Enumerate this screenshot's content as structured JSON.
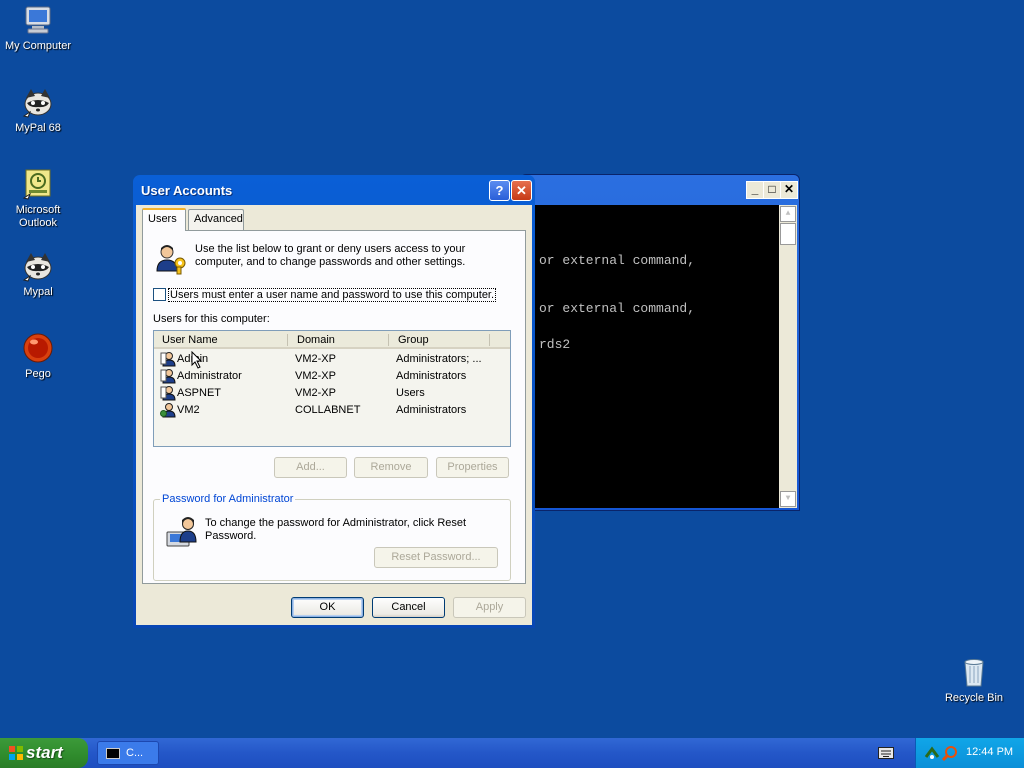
{
  "desktop": {
    "icons": [
      {
        "label": "My Computer",
        "icon": "computer-icon"
      },
      {
        "label": "MyPal 68",
        "icon": "raccoon-icon"
      },
      {
        "label": "Microsoft Outlook",
        "icon": "outlook-icon"
      },
      {
        "label": "Mypal",
        "icon": "raccoon-icon"
      },
      {
        "label": "Pego",
        "icon": "red-ball-icon"
      },
      {
        "label": "Recycle Bin",
        "icon": "recycle-bin-icon"
      }
    ]
  },
  "console": {
    "lines": [
      "or external command,",
      "or external command,",
      "rds2"
    ]
  },
  "dialog": {
    "title": "User Accounts",
    "help_glyph": "?",
    "close_glyph": "✕",
    "tabs": [
      "Users",
      "Advanced"
    ],
    "intro": "Use the list below to grant or deny users access to your computer, and to change passwords and other settings.",
    "checkbox_label": "Users must enter a user name and password to use this computer.",
    "checkbox_checked": false,
    "list_label": "Users for this computer:",
    "columns": [
      "User Name",
      "Domain",
      "Group"
    ],
    "rows": [
      {
        "name": "Admin",
        "domain": "VM2-XP",
        "group": "Administrators; ..."
      },
      {
        "name": "Administrator",
        "domain": "VM2-XP",
        "group": "Administrators"
      },
      {
        "name": "ASPNET",
        "domain": "VM2-XP",
        "group": "Users"
      },
      {
        "name": "VM2",
        "domain": "COLLABNET",
        "group": "Administrators"
      }
    ],
    "buttons": {
      "add": "Add...",
      "remove": "Remove",
      "properties": "Properties"
    },
    "password_group_title": "Password for Administrator",
    "password_text": "To change the password for Administrator, click Reset Password.",
    "reset_password": "Reset Password...",
    "ok": "OK",
    "cancel": "Cancel",
    "apply": "Apply"
  },
  "taskbar": {
    "start": "start",
    "items": [
      {
        "label": "C..."
      }
    ],
    "clock": "12:44 PM"
  },
  "colors": {
    "desktop": "#0c4b9f",
    "title_bar": "#0a5fd6",
    "dialog_face": "#ece9d8",
    "start_green": "#2f8b2c",
    "tray_blue": "#0b8fd8"
  }
}
